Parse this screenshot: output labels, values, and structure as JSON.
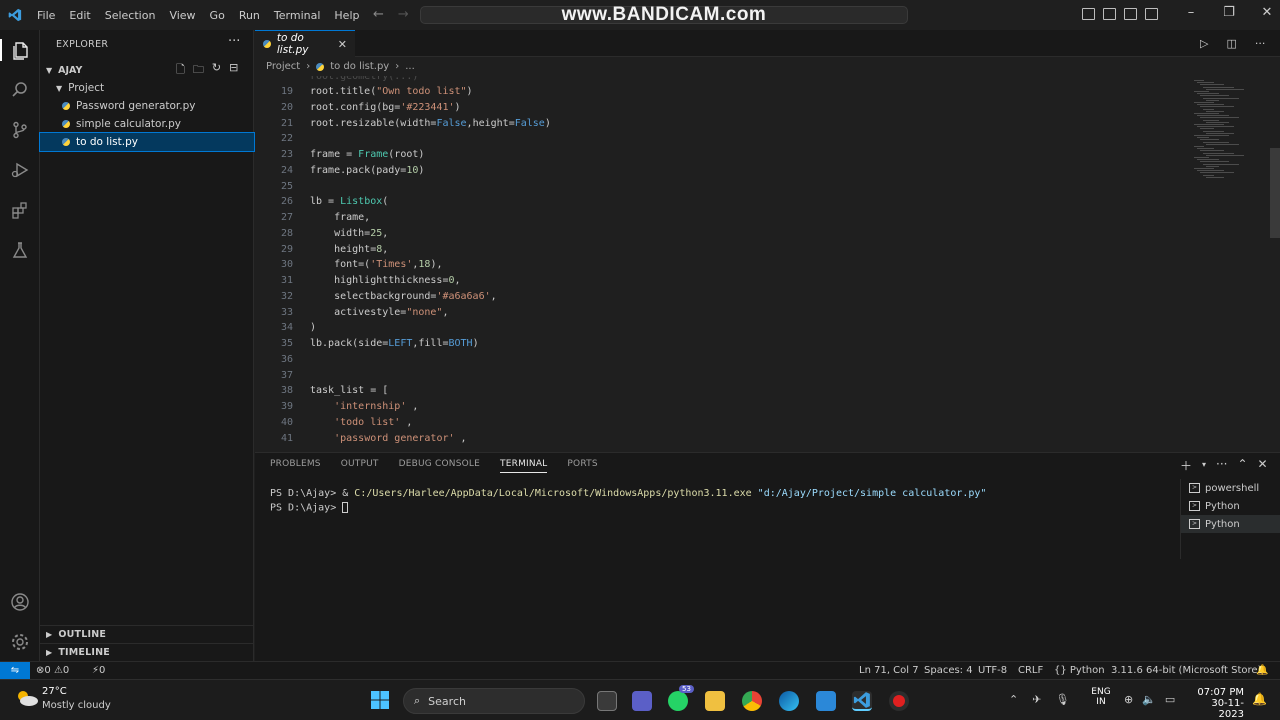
{
  "menu": [
    "File",
    "Edit",
    "Selection",
    "View",
    "Go",
    "Run",
    "Terminal",
    "Help"
  ],
  "watermark": "www.BANDICAM.com",
  "explorer": {
    "title": "EXPLORER",
    "more": "···",
    "root": "AJAY",
    "folder": "Project",
    "files": [
      "Password generator.py",
      "simple calculator.py",
      "to do list.py"
    ],
    "selected_index": 2,
    "outline": "OUTLINE",
    "timeline": "TIMELINE"
  },
  "editor": {
    "tab": "to do list.py",
    "breadcrumb": [
      "Project",
      "to do list.py",
      "..."
    ],
    "lines": [
      {
        "n": "19",
        "t": "root.title(\"Own todo list\")"
      },
      {
        "n": "20",
        "t": "root.config(bg='#223441')"
      },
      {
        "n": "21",
        "t": "root.resizable(width=False,height=False)"
      },
      {
        "n": "22",
        "t": ""
      },
      {
        "n": "23",
        "t": "frame = Frame(root)"
      },
      {
        "n": "24",
        "t": "frame.pack(pady=10)"
      },
      {
        "n": "25",
        "t": ""
      },
      {
        "n": "26",
        "t": "lb = Listbox("
      },
      {
        "n": "27",
        "t": "    frame,"
      },
      {
        "n": "28",
        "t": "    width=25,"
      },
      {
        "n": "29",
        "t": "    height=8,"
      },
      {
        "n": "30",
        "t": "    font=('Times',18),"
      },
      {
        "n": "31",
        "t": "    highlightthickness=0,"
      },
      {
        "n": "32",
        "t": "    selectbackground='#a6a6a6',"
      },
      {
        "n": "33",
        "t": "    activestyle=\"none\","
      },
      {
        "n": "34",
        "t": ")"
      },
      {
        "n": "35",
        "t": "lb.pack(side=LEFT,fill=BOTH)"
      },
      {
        "n": "36",
        "t": ""
      },
      {
        "n": "37",
        "t": ""
      },
      {
        "n": "38",
        "t": "task_list = ["
      },
      {
        "n": "39",
        "t": "    'internship' ,"
      },
      {
        "n": "40",
        "t": "    'todo list' ,"
      },
      {
        "n": "41",
        "t": "    'password generator' ,"
      }
    ]
  },
  "panel": {
    "tabs": [
      "PROBLEMS",
      "OUTPUT",
      "DEBUG CONSOLE",
      "TERMINAL",
      "PORTS"
    ],
    "active_tab": "TERMINAL",
    "terminal": {
      "line1_prompt": "PS D:\\Ajay> & ",
      "line1_exe": "C:/Users/Harlee/AppData/Local/Microsoft/WindowsApps/python3.11.exe",
      "line1_arg": " \"d:/Ajay/Project/simple calculator.py\"",
      "line2": "PS D:\\Ajay> "
    },
    "instances": [
      "powershell",
      "Python",
      "Python"
    ]
  },
  "statusbar": {
    "errors": "0",
    "warnings": "0",
    "ports": "0",
    "position": "Ln 71, Col 7",
    "spaces": "Spaces: 4",
    "encoding": "UTF-8",
    "eol": "CRLF",
    "language": "Python",
    "interpreter": "3.11.6 64-bit (Microsoft Store)"
  },
  "taskbar": {
    "weather_temp": "27°C",
    "weather_desc": "Mostly cloudy",
    "search": "Search",
    "lang1": "ENG",
    "lang2": "IN",
    "time": "07:07 PM",
    "date": "30-11-2023",
    "badge": "53"
  }
}
